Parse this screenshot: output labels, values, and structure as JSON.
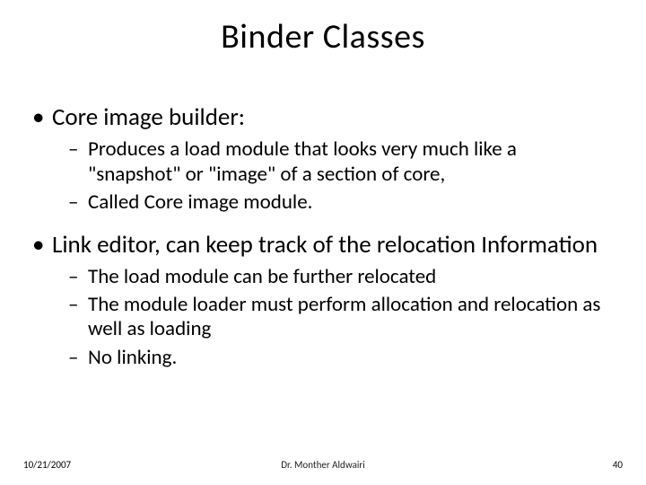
{
  "title": "Binder Classes",
  "bullets": {
    "item1": "Core image builder:",
    "item1_sub1": "Produces a load module that looks very much like a \"snapshot\" or \"image\" of a section of core,",
    "item1_sub2": "Called Core image module.",
    "item2": "Link editor, can keep track of the relocation Information",
    "item2_sub1": "The load module can be further relocated",
    "item2_sub2": "The module loader must perform allocation and relocation as well as loading",
    "item2_sub3": "No linking."
  },
  "footer": {
    "date": "10/21/2007",
    "author": "Dr. Monther Aldwairi",
    "page": "40"
  }
}
